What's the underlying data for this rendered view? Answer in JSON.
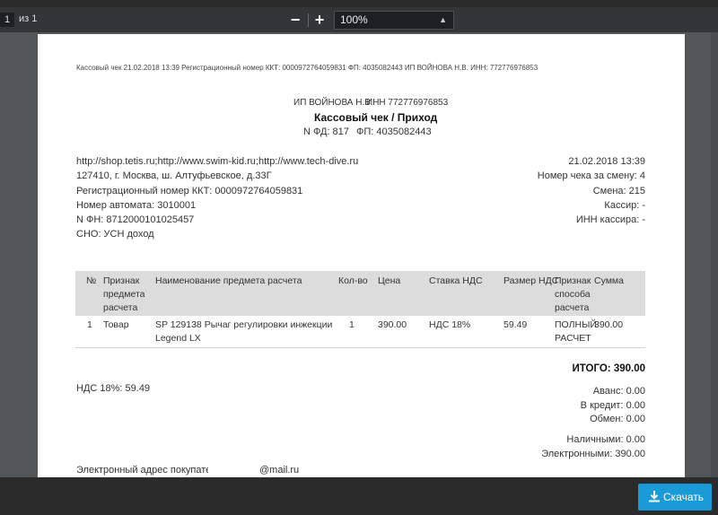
{
  "toolbar": {
    "page_current": "1",
    "page_total": "из 1",
    "zoom_out": "−",
    "zoom_in": "+",
    "zoom_level": "100%"
  },
  "receipt": {
    "header_line": "Кассовый чек 21.02.2018 13:39 Регистрационный номер ККТ: 0000972764059831 ФП: 4035082443 ИП ВОЙНОВА Н.В. ИНН: 772776976853",
    "seller": "ИП ВОЙНОВА Н.В.",
    "inn": "ИНН 772776976853",
    "doc_title": "Кассовый чек / Приход",
    "fd_no": "N ФД: 817",
    "fp_no": "ФП: 4035082443",
    "left_info": [
      "http://shop.tetis.ru;http://www.swim-kid.ru;http://www.tech-dive.ru",
      "127410, г. Москва, ш. Алтуфьевское, д.33Г",
      "Регистрационный номер ККТ: 0000972764059831",
      "Номер автомата: 3010001",
      "N ФН: 8712000101025457",
      "СНО: УСН доход"
    ],
    "right_info": [
      "21.02.2018 13:39",
      "Номер чека за смену: 4",
      "Смена: 215",
      "Кассир: -",
      "ИНН кассира: -"
    ],
    "table": {
      "headers": {
        "no": "№",
        "sign": [
          "Признак",
          "предмета",
          "расчета"
        ],
        "name": "Наименование предмета расчета",
        "qty": "Кол-во",
        "price": "Цена",
        "vat_rate": "Ставка НДС",
        "vat_amount": "Размер НДС",
        "method": [
          "Признак",
          "способа",
          "расчета"
        ],
        "sum": "Сумма"
      },
      "row": {
        "no": "1",
        "sign": "Товар",
        "name": [
          "SP 129138 Рычаг регулировки инжекции",
          "Legend LX"
        ],
        "qty": "1",
        "price": "390.00",
        "vat_rate": "НДС 18%",
        "vat_amount": "59.49",
        "method": [
          "ПОЛНЫЙ",
          "РАСЧЕТ"
        ],
        "sum": "390.00"
      }
    },
    "total": "ИТОГО: 390.00",
    "vat_total": "НДС 18%: 59.49",
    "payments": [
      "Аванс: 0.00",
      "В кредит: 0.00",
      "Обмен: 0.00"
    ],
    "payments2": [
      "Наличными: 0.00",
      "Электронными: 390.00"
    ],
    "email_label": "Электронный адрес покупателя: alex",
    "email_domain": "@mail.ru"
  },
  "download": {
    "label": "Скачать",
    "accent": "#1a9bd7"
  }
}
